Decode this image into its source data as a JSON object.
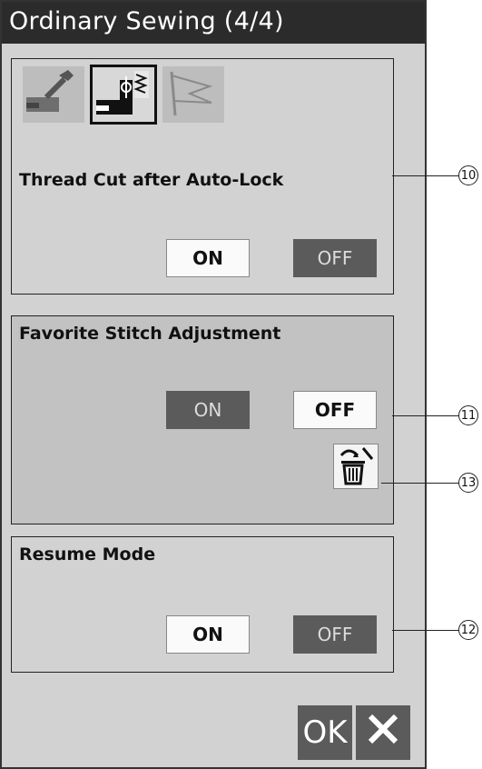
{
  "title": "Ordinary Sewing (4/4)",
  "tabs": [
    {
      "name": "settings-tab",
      "icon": "wrench-machine-icon"
    },
    {
      "name": "sewing-tab",
      "icon": "needle-machine-icon"
    },
    {
      "name": "flag-tab",
      "icon": "flag-icon"
    }
  ],
  "thread_cut": {
    "label": "Thread Cut after Auto-Lock",
    "on": "ON",
    "off": "OFF",
    "selected": "ON"
  },
  "favorite": {
    "label": "Favorite Stitch Adjustment",
    "on": "ON",
    "off": "OFF",
    "selected": "OFF"
  },
  "resume": {
    "label": "Resume Mode",
    "on": "ON",
    "off": "OFF",
    "selected": "ON"
  },
  "footer": {
    "ok": "OK",
    "close_icon": "close-icon"
  },
  "callouts": {
    "c10": "10",
    "c11": "11",
    "c12": "12",
    "c13": "13"
  }
}
